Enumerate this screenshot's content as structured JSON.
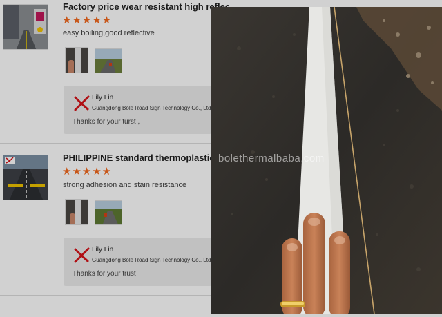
{
  "reviews": [
    {
      "title": "Factory price wear resistant high reflective ther",
      "rating": 5,
      "stars": "★★★★★",
      "comment": "easy boiling,good reflective",
      "reply": {
        "name": "Lily Lin",
        "company": "Guangdong Bole Road Sign Technology Co., Ltd",
        "text": "Thanks for your turst ,"
      }
    },
    {
      "title": "PHILIPPINE standard thermoplastic road ma",
      "rating": 5,
      "stars": "★★★★★",
      "comment": "strong adhesion and stain resistance",
      "reply": {
        "name": "Lily Lin",
        "company": "Guangdong Bole Road Sign Technology Co., Ltd",
        "text": "Thanks for your trust"
      }
    }
  ],
  "viewer": {
    "watermark": "bolethermalbaba.com"
  },
  "colors": {
    "star": "#f56a1e",
    "reply_bg": "#ececec",
    "logo_red": "#d7141a"
  }
}
